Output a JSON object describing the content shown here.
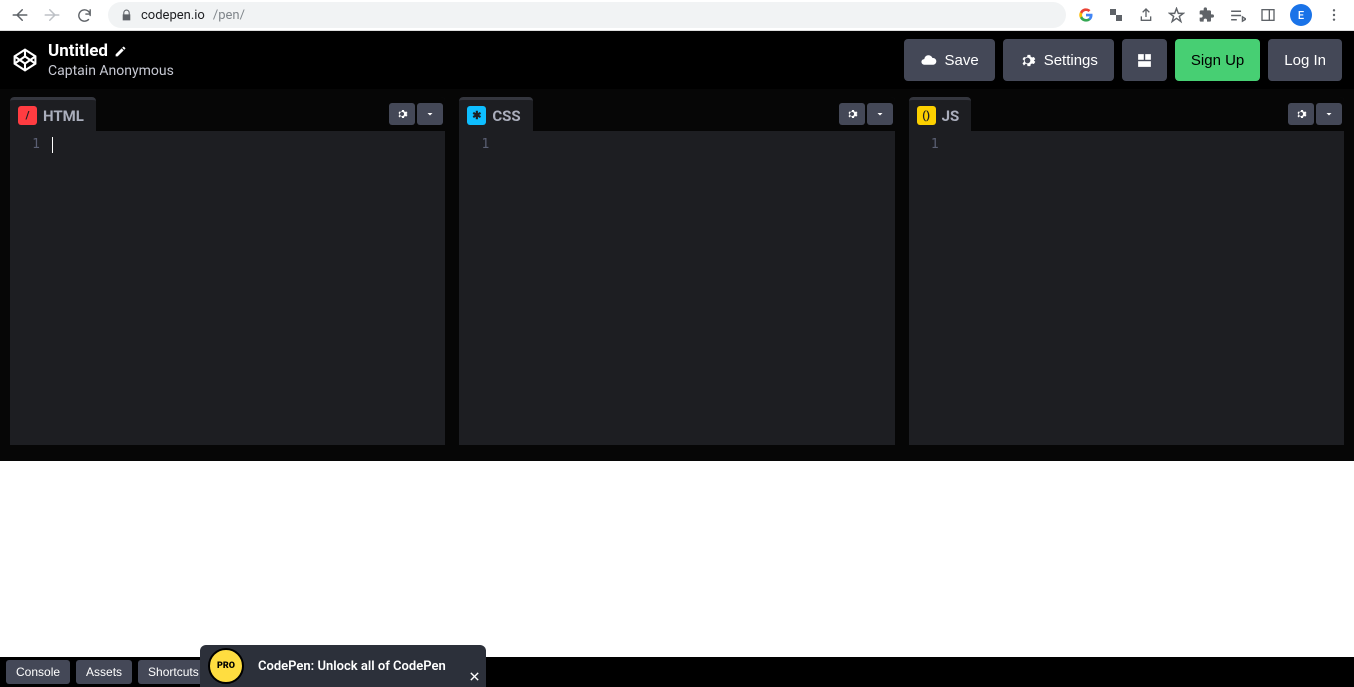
{
  "browser": {
    "url_host": "codepen.io",
    "url_path": "/pen/",
    "avatar_initial": "E"
  },
  "header": {
    "title": "Untitled",
    "author": "Captain Anonymous",
    "save_label": "Save",
    "settings_label": "Settings",
    "signup_label": "Sign Up",
    "login_label": "Log In"
  },
  "editors": [
    {
      "lang": "HTML",
      "badge": "/",
      "badge_class": "html",
      "line": "1",
      "has_cursor": true
    },
    {
      "lang": "CSS",
      "badge": "✱",
      "badge_class": "css",
      "line": "1",
      "has_cursor": false
    },
    {
      "lang": "JS",
      "badge": "()",
      "badge_class": "js",
      "line": "1",
      "has_cursor": false
    }
  ],
  "footer": {
    "console_label": "Console",
    "assets_label": "Assets",
    "shortcuts_label": "Shortcuts",
    "pro_badge": "PRO",
    "promo_text": "CodePen: Unlock all of CodePen"
  }
}
